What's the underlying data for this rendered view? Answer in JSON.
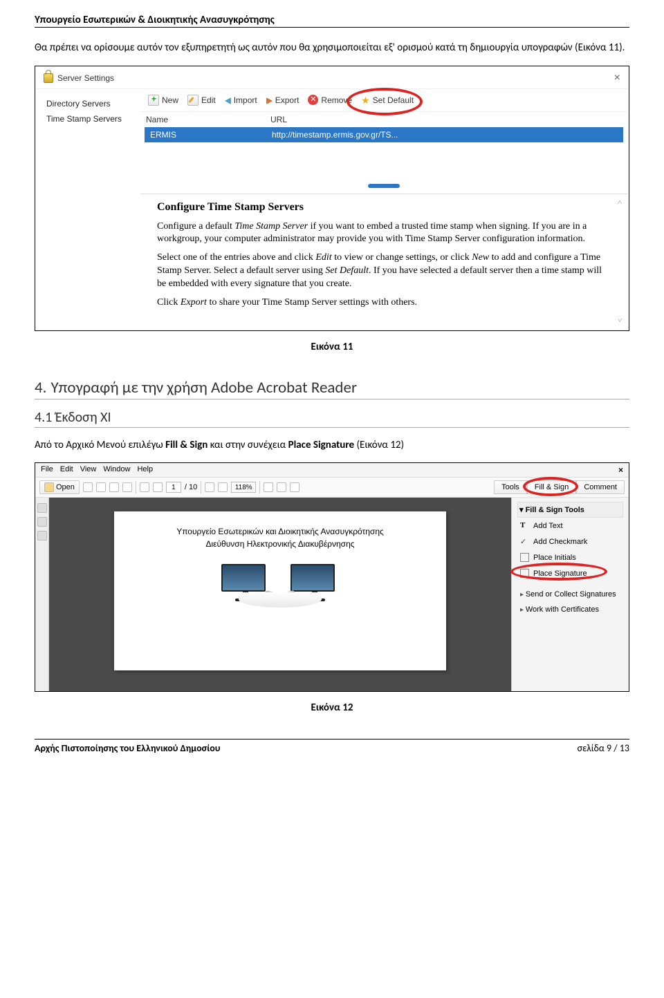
{
  "header": "Υπουργείο Εσωτερικών & Διοικητικής Ανασυγκρότησης",
  "intro_para": "Θα πρέπει να ορίσουμε αυτόν τον εξυπηρετητή ως αυτόν που θα χρησιμοποιείται εξ' ορισμού κατά τη δημιουργία υπογραφών (Εικόνα 11).",
  "fig1": {
    "dialog_title": "Server Settings",
    "close": "×",
    "side": [
      "Directory Servers",
      "Time Stamp Servers"
    ],
    "toolbar": {
      "new": "New",
      "edit": "Edit",
      "import": "Import",
      "export": "Export",
      "remove": "Remove",
      "setdefault": "Set Default"
    },
    "table": {
      "col_name": "Name",
      "col_url": "URL",
      "row_name": "ERMIS",
      "row_url": "http://timestamp.ermis.gov.gr/TS..."
    },
    "info": {
      "heading": "Configure Time Stamp Servers",
      "p1a": "Configure a default ",
      "p1b": "Time Stamp Server",
      "p1c": " if you want to embed a trusted time stamp when signing. If you are in a workgroup, your computer administrator may provide you with Time Stamp Server configuration information.",
      "p2a": "Select one of the entries above and click ",
      "p2b": "Edit",
      "p2c": " to view or change settings, or click ",
      "p2d": "New",
      "p2e": " to add and configure a Time Stamp Server. Select a default server using ",
      "p2f": "Set Default",
      "p2g": ". If you have selected a default server then a time stamp will be embedded with every signature that you create.",
      "p3a": "Click ",
      "p3b": "Export",
      "p3c": " to share your Time Stamp Server settings with others."
    }
  },
  "caption1": "Εικόνα 11",
  "sec4_num": "4.",
  "sec4_title": "Υπογραφή με την χρήση Adobe Acrobat Reader",
  "sec41_num": "4.1",
  "sec41_title": "Έκδοση XI",
  "para_fig2_a": "Από το Αρχικό Μενού επιλέγω ",
  "para_fig2_b": "Fill & Sign",
  "para_fig2_c": " και στην συνέχεια ",
  "para_fig2_d": "Place Signature",
  "para_fig2_e": " (Εικόνα 12)",
  "fig2": {
    "menu": [
      "File",
      "Edit",
      "View",
      "Window",
      "Help"
    ],
    "open": "Open",
    "page_cur": "1",
    "page_sep": "/ 10",
    "zoom": "118%",
    "tabs": {
      "tools": "Tools",
      "fillsign": "Fill & Sign",
      "comment": "Comment"
    },
    "doc_title_l1": "Υπουργείο Εσωτερικών και Διοικητικής Ανασυγκρότησης",
    "doc_title_l2": "Διεύθυνση Ηλεκτρονικής Διακυβέρνησης",
    "panel": {
      "header": "▾  Fill & Sign Tools",
      "addtext": "Add Text",
      "addcheck": "Add Checkmark",
      "placeinit": "Place Initials",
      "placesig": "Place Signature",
      "send": "Send or Collect Signatures",
      "work": "Work with Certificates"
    }
  },
  "caption2": "Εικόνα 12",
  "footer_left": "Αρχής Πιστοποίησης του Ελληνικού Δημοσίου",
  "footer_right": "σελίδα 9 / 13"
}
